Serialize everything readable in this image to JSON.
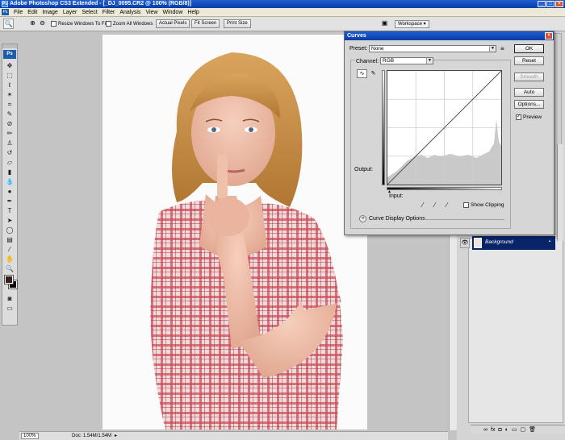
{
  "titlebar": {
    "title": "Adobe Photoshop CS3 Extended - [_DJ_0095.CR2 @ 100% (RGB/8)]"
  },
  "menubar": {
    "items": [
      "File",
      "Edit",
      "Image",
      "Layer",
      "Select",
      "Filter",
      "Analysis",
      "View",
      "Window",
      "Help"
    ]
  },
  "options": {
    "resize_windows": "Resize Windows To Fit",
    "zoom_all": "Zoom All Windows",
    "actual_pixels": "Actual Pixels",
    "fit_screen": "Fit Screen",
    "print_size": "Print Size",
    "workspace": "Workspace ▾"
  },
  "toolbox": {
    "logo": "Ps"
  },
  "statusbar": {
    "zoom": "100%",
    "doc": "Doc: 1.54M/1.54M"
  },
  "layers": {
    "layer_name": "Background"
  },
  "curves": {
    "title": "Curves",
    "preset_label": "Preset:",
    "preset_value": "None",
    "channel_label": "Channel:",
    "channel_value": "RGB",
    "output_label": "Output:",
    "input_label": "Input:",
    "show_clipping": "Show Clipping",
    "curve_display_options": "Curve Display Options",
    "buttons": {
      "ok": "OK",
      "reset": "Reset",
      "smooth": "Smooth",
      "auto": "Auto",
      "options": "Options...",
      "preview": "Preview"
    },
    "preview_checked": true,
    "show_clipping_checked": false
  },
  "colors": {
    "titlebar": "#0a3ca8",
    "selection": "#0a246a",
    "foreground_swatch": "#3a1e1c",
    "background_swatch": "#000000"
  }
}
